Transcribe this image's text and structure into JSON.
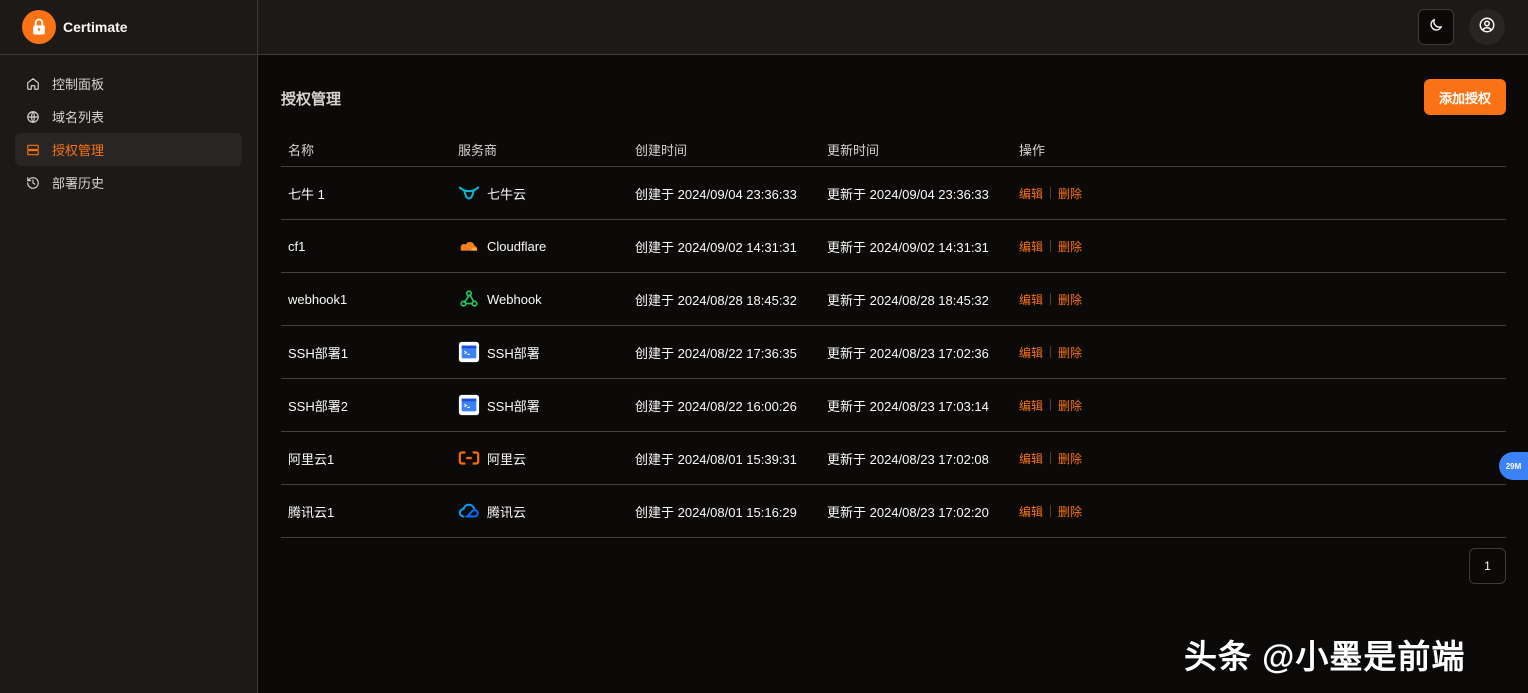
{
  "brand": {
    "name": "Certimate"
  },
  "nav": {
    "items": [
      {
        "label": "控制面板",
        "icon": "home-icon"
      },
      {
        "label": "域名列表",
        "icon": "globe-icon"
      },
      {
        "label": "授权管理",
        "icon": "server-icon"
      },
      {
        "label": "部署历史",
        "icon": "history-icon"
      }
    ],
    "active_index": 2
  },
  "header": {
    "theme_icon": "moon-icon",
    "user_icon": "user-circle-icon"
  },
  "page": {
    "title": "授权管理",
    "add_button": "添加授权"
  },
  "table": {
    "columns": [
      "名称",
      "服务商",
      "创建时间",
      "更新时间",
      "操作"
    ],
    "rows": [
      {
        "name": "七牛 1",
        "provider": "七牛云",
        "provider_icon": "qiniu-icon",
        "created": "创建于 2024/09/04 23:36:33",
        "updated": "更新于 2024/09/04 23:36:33",
        "edit": "编辑",
        "delete": "删除"
      },
      {
        "name": "cf1",
        "provider": "Cloudflare",
        "provider_icon": "cloudflare-icon",
        "created": "创建于 2024/09/02 14:31:31",
        "updated": "更新于 2024/09/02 14:31:31",
        "edit": "编辑",
        "delete": "删除"
      },
      {
        "name": "webhook1",
        "provider": "Webhook",
        "provider_icon": "webhook-icon",
        "created": "创建于 2024/08/28 18:45:32",
        "updated": "更新于 2024/08/28 18:45:32",
        "edit": "编辑",
        "delete": "删除"
      },
      {
        "name": "SSH部署1",
        "provider": "SSH部署",
        "provider_icon": "ssh-icon",
        "created": "创建于 2024/08/22 17:36:35",
        "updated": "更新于 2024/08/23 17:02:36",
        "edit": "编辑",
        "delete": "删除"
      },
      {
        "name": "SSH部署2",
        "provider": "SSH部署",
        "provider_icon": "ssh-icon",
        "created": "创建于 2024/08/22 16:00:26",
        "updated": "更新于 2024/08/23 17:03:14",
        "edit": "编辑",
        "delete": "删除"
      },
      {
        "name": "阿里云1",
        "provider": "阿里云",
        "provider_icon": "aliyun-icon",
        "created": "创建于 2024/08/01 15:39:31",
        "updated": "更新于 2024/08/23 17:02:08",
        "edit": "编辑",
        "delete": "删除"
      },
      {
        "name": "腾讯云1",
        "provider": "腾讯云",
        "provider_icon": "tencent-cloud-icon",
        "created": "创建于 2024/08/01 15:16:29",
        "updated": "更新于 2024/08/23 17:02:20",
        "edit": "编辑",
        "delete": "删除"
      }
    ]
  },
  "pagination": {
    "current": "1"
  },
  "float_badge": "29M",
  "watermark": "头条 @小墨是前端",
  "colors": {
    "accent": "#f97316",
    "background": "#0c0a09",
    "sidebar": "#1c1917"
  }
}
